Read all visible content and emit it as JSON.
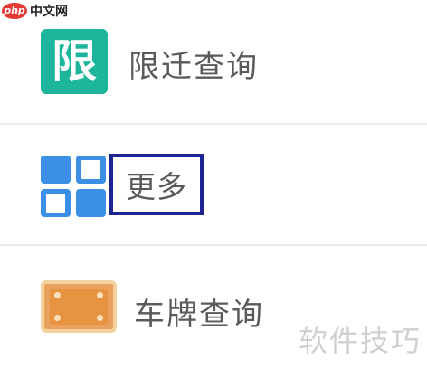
{
  "watermark": {
    "logo_text": "php",
    "site_text": "中文网",
    "bottom_text": "软件技巧"
  },
  "menu": {
    "items": [
      {
        "label": "限迁查询",
        "icon": "limit-icon",
        "icon_text": "限",
        "icon_color": "#1db59b"
      },
      {
        "label": "更多",
        "icon": "grid-icon",
        "icon_color": "#3b8fe4",
        "highlight_color": "#1b2490"
      },
      {
        "label": "车牌查询",
        "icon": "license-plate-icon",
        "icon_color": "#e9a25e"
      }
    ]
  }
}
